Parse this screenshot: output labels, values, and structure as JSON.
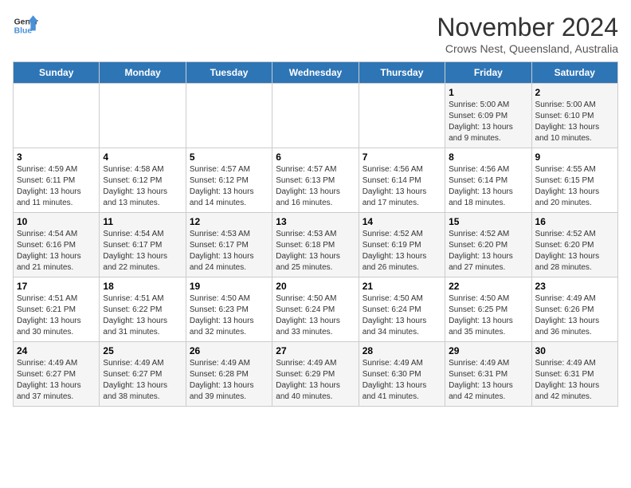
{
  "logo": {
    "line1": "General",
    "line2": "Blue"
  },
  "title": "November 2024",
  "subtitle": "Crows Nest, Queensland, Australia",
  "weekdays": [
    "Sunday",
    "Monday",
    "Tuesday",
    "Wednesday",
    "Thursday",
    "Friday",
    "Saturday"
  ],
  "weeks": [
    [
      {
        "day": "",
        "detail": ""
      },
      {
        "day": "",
        "detail": ""
      },
      {
        "day": "",
        "detail": ""
      },
      {
        "day": "",
        "detail": ""
      },
      {
        "day": "",
        "detail": ""
      },
      {
        "day": "1",
        "detail": "Sunrise: 5:00 AM\nSunset: 6:09 PM\nDaylight: 13 hours\nand 9 minutes."
      },
      {
        "day": "2",
        "detail": "Sunrise: 5:00 AM\nSunset: 6:10 PM\nDaylight: 13 hours\nand 10 minutes."
      }
    ],
    [
      {
        "day": "3",
        "detail": "Sunrise: 4:59 AM\nSunset: 6:11 PM\nDaylight: 13 hours\nand 11 minutes."
      },
      {
        "day": "4",
        "detail": "Sunrise: 4:58 AM\nSunset: 6:12 PM\nDaylight: 13 hours\nand 13 minutes."
      },
      {
        "day": "5",
        "detail": "Sunrise: 4:57 AM\nSunset: 6:12 PM\nDaylight: 13 hours\nand 14 minutes."
      },
      {
        "day": "6",
        "detail": "Sunrise: 4:57 AM\nSunset: 6:13 PM\nDaylight: 13 hours\nand 16 minutes."
      },
      {
        "day": "7",
        "detail": "Sunrise: 4:56 AM\nSunset: 6:14 PM\nDaylight: 13 hours\nand 17 minutes."
      },
      {
        "day": "8",
        "detail": "Sunrise: 4:56 AM\nSunset: 6:14 PM\nDaylight: 13 hours\nand 18 minutes."
      },
      {
        "day": "9",
        "detail": "Sunrise: 4:55 AM\nSunset: 6:15 PM\nDaylight: 13 hours\nand 20 minutes."
      }
    ],
    [
      {
        "day": "10",
        "detail": "Sunrise: 4:54 AM\nSunset: 6:16 PM\nDaylight: 13 hours\nand 21 minutes."
      },
      {
        "day": "11",
        "detail": "Sunrise: 4:54 AM\nSunset: 6:17 PM\nDaylight: 13 hours\nand 22 minutes."
      },
      {
        "day": "12",
        "detail": "Sunrise: 4:53 AM\nSunset: 6:17 PM\nDaylight: 13 hours\nand 24 minutes."
      },
      {
        "day": "13",
        "detail": "Sunrise: 4:53 AM\nSunset: 6:18 PM\nDaylight: 13 hours\nand 25 minutes."
      },
      {
        "day": "14",
        "detail": "Sunrise: 4:52 AM\nSunset: 6:19 PM\nDaylight: 13 hours\nand 26 minutes."
      },
      {
        "day": "15",
        "detail": "Sunrise: 4:52 AM\nSunset: 6:20 PM\nDaylight: 13 hours\nand 27 minutes."
      },
      {
        "day": "16",
        "detail": "Sunrise: 4:52 AM\nSunset: 6:20 PM\nDaylight: 13 hours\nand 28 minutes."
      }
    ],
    [
      {
        "day": "17",
        "detail": "Sunrise: 4:51 AM\nSunset: 6:21 PM\nDaylight: 13 hours\nand 30 minutes."
      },
      {
        "day": "18",
        "detail": "Sunrise: 4:51 AM\nSunset: 6:22 PM\nDaylight: 13 hours\nand 31 minutes."
      },
      {
        "day": "19",
        "detail": "Sunrise: 4:50 AM\nSunset: 6:23 PM\nDaylight: 13 hours\nand 32 minutes."
      },
      {
        "day": "20",
        "detail": "Sunrise: 4:50 AM\nSunset: 6:24 PM\nDaylight: 13 hours\nand 33 minutes."
      },
      {
        "day": "21",
        "detail": "Sunrise: 4:50 AM\nSunset: 6:24 PM\nDaylight: 13 hours\nand 34 minutes."
      },
      {
        "day": "22",
        "detail": "Sunrise: 4:50 AM\nSunset: 6:25 PM\nDaylight: 13 hours\nand 35 minutes."
      },
      {
        "day": "23",
        "detail": "Sunrise: 4:49 AM\nSunset: 6:26 PM\nDaylight: 13 hours\nand 36 minutes."
      }
    ],
    [
      {
        "day": "24",
        "detail": "Sunrise: 4:49 AM\nSunset: 6:27 PM\nDaylight: 13 hours\nand 37 minutes."
      },
      {
        "day": "25",
        "detail": "Sunrise: 4:49 AM\nSunset: 6:27 PM\nDaylight: 13 hours\nand 38 minutes."
      },
      {
        "day": "26",
        "detail": "Sunrise: 4:49 AM\nSunset: 6:28 PM\nDaylight: 13 hours\nand 39 minutes."
      },
      {
        "day": "27",
        "detail": "Sunrise: 4:49 AM\nSunset: 6:29 PM\nDaylight: 13 hours\nand 40 minutes."
      },
      {
        "day": "28",
        "detail": "Sunrise: 4:49 AM\nSunset: 6:30 PM\nDaylight: 13 hours\nand 41 minutes."
      },
      {
        "day": "29",
        "detail": "Sunrise: 4:49 AM\nSunset: 6:31 PM\nDaylight: 13 hours\nand 42 minutes."
      },
      {
        "day": "30",
        "detail": "Sunrise: 4:49 AM\nSunset: 6:31 PM\nDaylight: 13 hours\nand 42 minutes."
      }
    ]
  ]
}
